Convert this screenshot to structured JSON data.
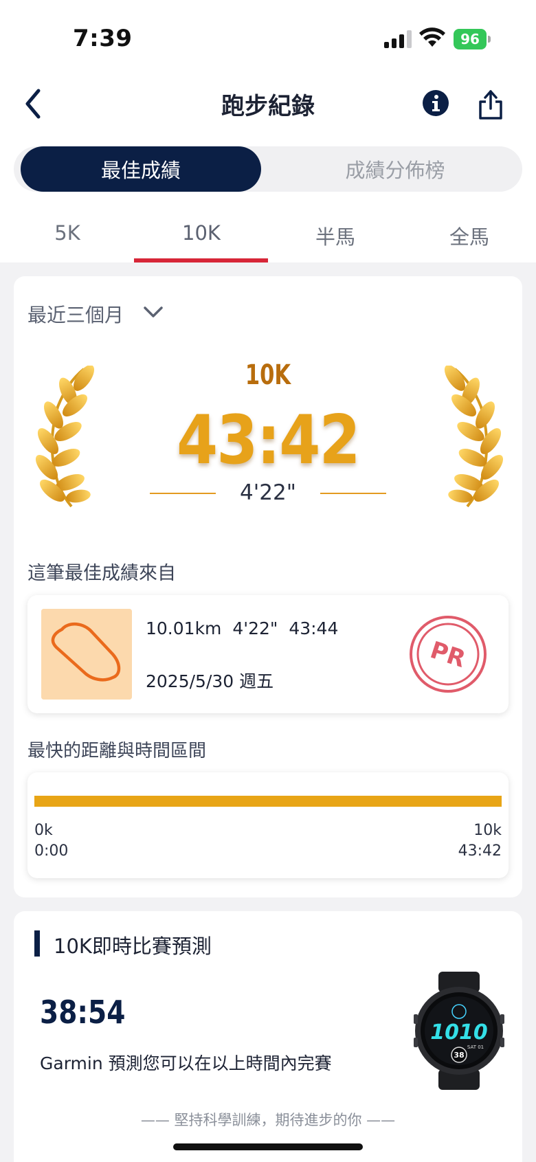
{
  "status_bar": {
    "time": "7:39",
    "battery": "96",
    "battery_color": "#34c759"
  },
  "header": {
    "title": "跑步紀錄",
    "back_icon": "chevron-left-icon",
    "info_icon": "info-icon",
    "share_icon": "share-icon"
  },
  "segment": {
    "active_label": "最佳成績",
    "inactive_label": "成績分佈榜",
    "active_color": "#0b1f45"
  },
  "distance_tabs": [
    {
      "label": "5K",
      "active": false
    },
    {
      "label": "10K",
      "active": true
    },
    {
      "label": "半馬",
      "active": false
    },
    {
      "label": "全馬",
      "active": false
    }
  ],
  "accent_color": "#d72638",
  "best": {
    "period": "最近三個月",
    "distance": "10K",
    "time": "43:42",
    "pace": "4'22\"",
    "gold_color": "#e7a21a"
  },
  "source": {
    "label": "這筆最佳成績來自",
    "distance": "10.01km",
    "pace": "4'22\"",
    "duration": "43:44",
    "date": "2025/5/30 週五",
    "badge": "PR",
    "badge_color": "#e05b6a"
  },
  "fastest": {
    "label": "最快的距離與時間區間",
    "start_km": "0k",
    "start_time": "0:00",
    "end_km": "10k",
    "end_time": "43:42",
    "fill_fraction": 1.0,
    "bar_color": "#e8a516"
  },
  "prediction": {
    "title": "10K即時比賽預測",
    "time": "38:54",
    "description": "Garmin 預測您可以在以上時間內完賽",
    "footer": "—— 堅持科學訓練，期待進步的你 ——",
    "watch_time": "1010",
    "watch_date": "SAT 01",
    "watch_num": "38"
  }
}
